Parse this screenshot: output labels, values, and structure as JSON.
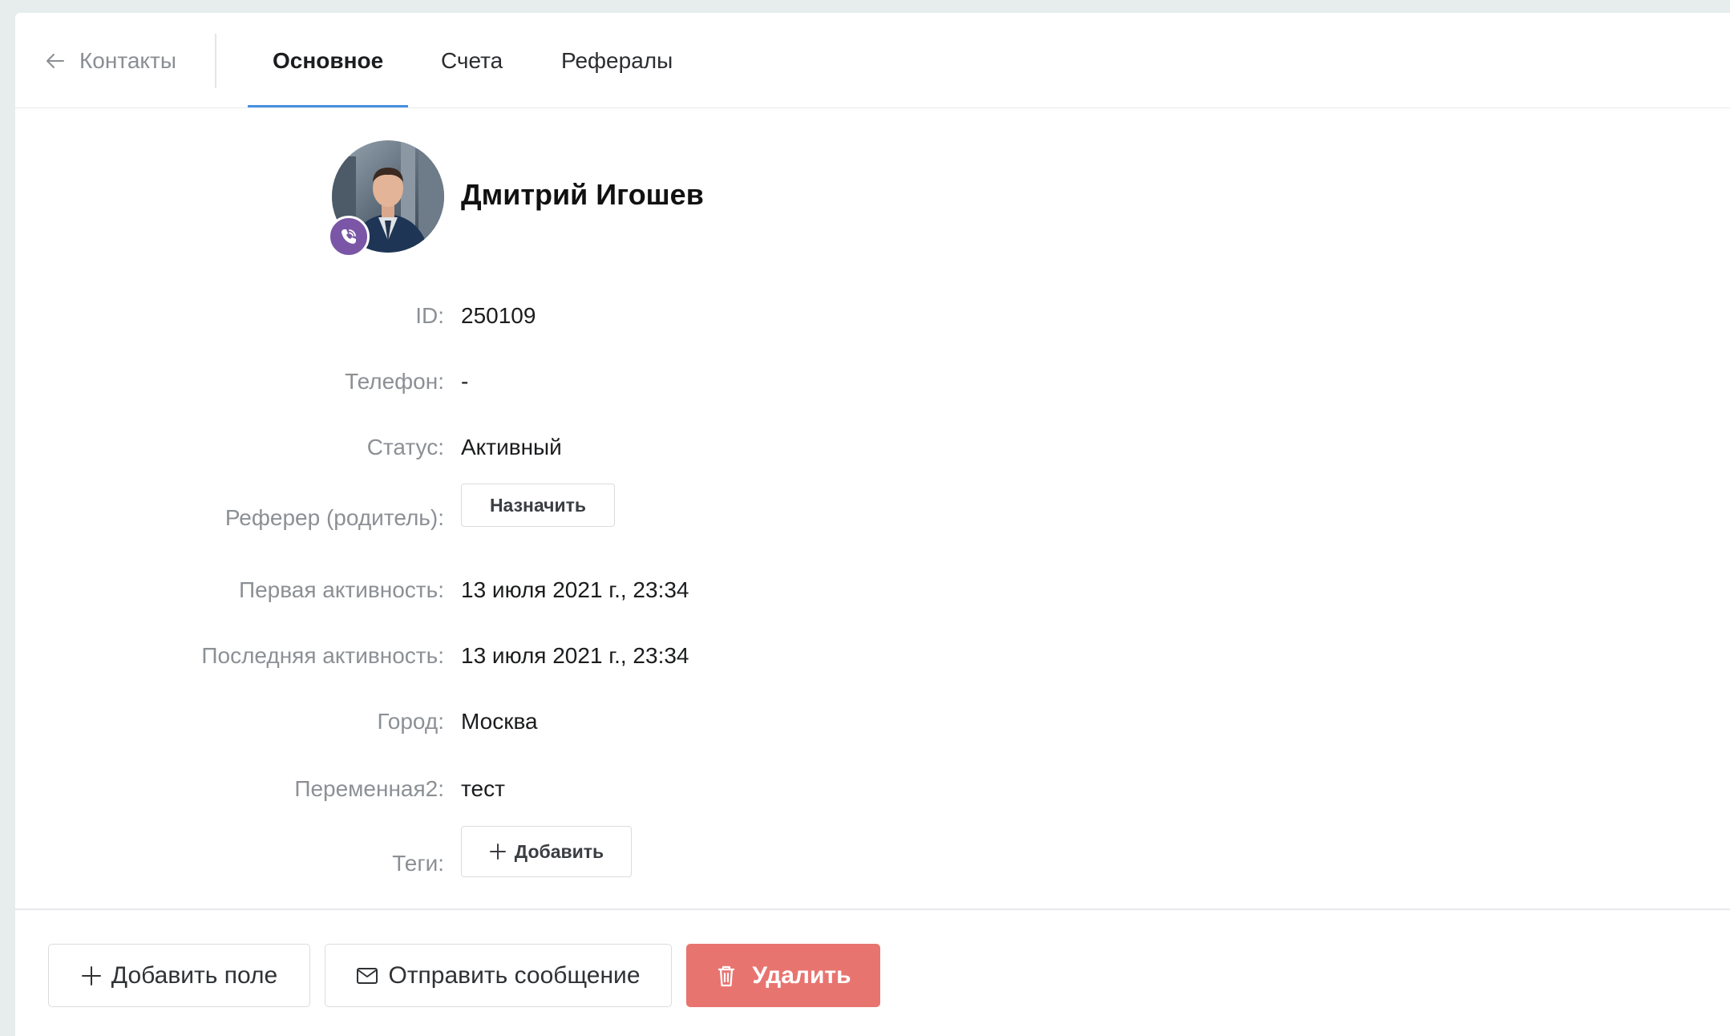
{
  "header": {
    "back_label": "Контакты",
    "tabs": [
      {
        "label": "Основное",
        "active": true
      },
      {
        "label": "Счета",
        "active": false
      },
      {
        "label": "Рефералы",
        "active": false
      }
    ]
  },
  "profile": {
    "name": "Дмитрий Игошев",
    "channel_icon": "viber-icon"
  },
  "fields": {
    "id": {
      "label": "ID:",
      "value": "250109"
    },
    "phone": {
      "label": "Телефон:",
      "value": "-"
    },
    "status": {
      "label": "Статус:",
      "value": "Активный"
    },
    "referrer": {
      "label": "Реферер (родитель):",
      "button": "Назначить"
    },
    "first_activity": {
      "label": "Первая активность:",
      "value": "13 июля 2021 г., 23:34"
    },
    "last_activity": {
      "label": "Последняя активность:",
      "value": "13 июля 2021 г., 23:34"
    },
    "city": {
      "label": "Город:",
      "value": "Москва"
    },
    "var2": {
      "label": "Переменная2:",
      "value": "тест"
    },
    "tags": {
      "label": "Теги:",
      "button": "Добавить"
    }
  },
  "footer": {
    "add_field": "Добавить поле",
    "send_message": "Отправить сообщение",
    "delete": "Удалить"
  },
  "colors": {
    "accent": "#4a90e2",
    "danger": "#e87470",
    "viber": "#7b56a6"
  }
}
